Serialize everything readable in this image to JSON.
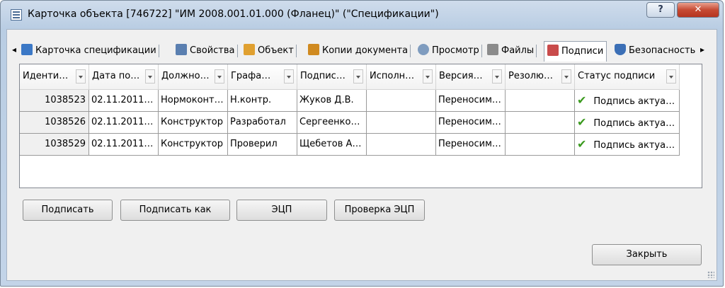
{
  "window": {
    "title": "Карточка объекта [746722] \"ИМ 2008.001.01.000 (Фланец)\" (\"Спецификации\")",
    "help_label": "?",
    "close_label": "✕"
  },
  "tabs": [
    {
      "label": "Карточка спецификации"
    },
    {
      "label": "Свойства"
    },
    {
      "label": "Объект"
    },
    {
      "label": "Копии документа"
    },
    {
      "label": "Просмотр"
    },
    {
      "label": "Файлы"
    },
    {
      "label": "Подписи"
    },
    {
      "label": "Безопасность"
    }
  ],
  "tab_nav": {
    "left": "◂",
    "right": "▸"
  },
  "grid": {
    "columns": [
      "Иденти…",
      "Дата по…",
      "Должно…",
      "Графа…",
      "Подпис…",
      "Исполн…",
      "Версия…",
      "Резолю…",
      "Статус подписи"
    ],
    "rows": [
      [
        "1038523",
        "02.11.2011…",
        "Нормоконт…",
        "Н.контр.",
        "Жуков Д.В.",
        "",
        "Переносим…",
        "",
        "Подпись актуа…"
      ],
      [
        "1038526",
        "02.11.2011…",
        "Конструктор",
        "Разработал",
        "Сергеенко…",
        "",
        "Переносим…",
        "",
        "Подпись актуа…"
      ],
      [
        "1038529",
        "02.11.2011…",
        "Конструктор",
        "Проверил",
        "Щебетов А…",
        "",
        "Переносим…",
        "",
        "Подпись актуа…"
      ]
    ],
    "check_glyph": "✔"
  },
  "buttons": {
    "sign": "Подписать",
    "sign_as": "Подписать как",
    "ecp": "ЭЦП",
    "check_ecp": "Проверка ЭЦП",
    "close": "Закрыть"
  },
  "colors": {
    "accent": "#3a9a1e",
    "close_red": "#c64a33"
  }
}
